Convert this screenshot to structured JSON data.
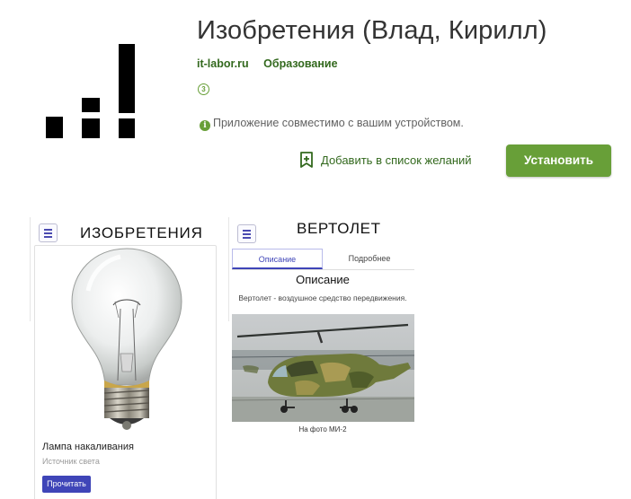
{
  "app": {
    "title": "Изобретения (Влад, Кирилл)",
    "developer": "it-labor.ru",
    "category": "Образование",
    "content_rating": "3",
    "compatibility": "Приложение совместимо с вашим устройством.",
    "wishlist_label": "Добавить в список желаний",
    "install_label": "Установить",
    "accent_color": "#689f38"
  },
  "screenshots": [
    {
      "header": "ИЗОБРЕТЕНИЯ",
      "card": {
        "title": "Лампа накаливания",
        "subtitle": "Источник света",
        "button": "Прочитать"
      }
    },
    {
      "header": "ВЕРТОЛЕТ",
      "tabs": [
        "Описание",
        "Подробнее"
      ],
      "section_title": "Описание",
      "description": "Вертолет - воздушное средство передвижения.",
      "caption": "На фото МИ-2"
    }
  ]
}
